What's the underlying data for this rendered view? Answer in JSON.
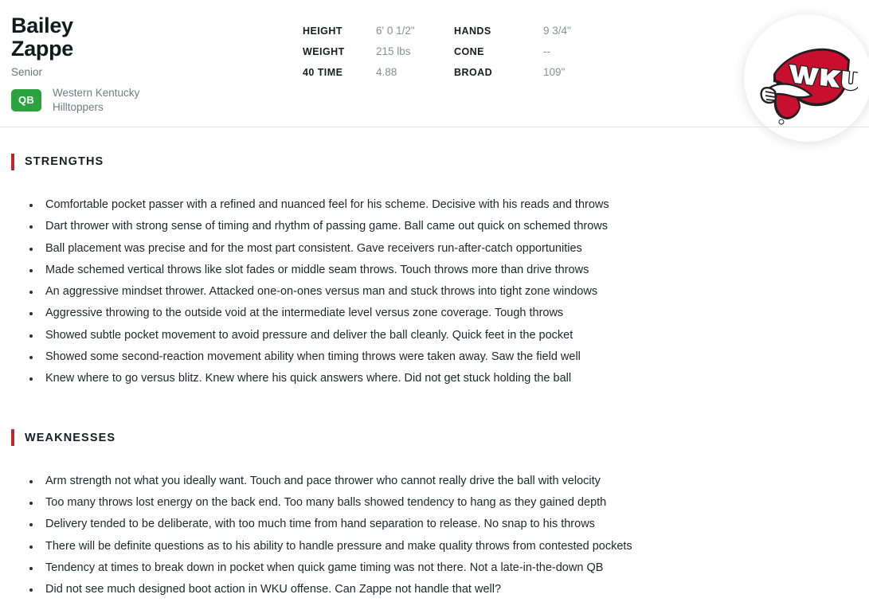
{
  "player": {
    "first_name": "Bailey",
    "last_name": "Zappe",
    "full_name": "Bailey\nZappe",
    "class_year": "Senior",
    "position": "QB",
    "team": "Western Kentucky\nHilltoppers",
    "team_abbr": "WKU"
  },
  "measurements": [
    {
      "label": "HEIGHT",
      "value": "6' 0 1/2\""
    },
    {
      "label": "HANDS",
      "value": "9 3/4\""
    },
    {
      "label": "WEIGHT",
      "value": "215 lbs"
    },
    {
      "label": "CONE",
      "value": "--"
    },
    {
      "label": "40 TIME",
      "value": "4.88"
    },
    {
      "label": "BROAD",
      "value": "109\""
    }
  ],
  "sections": {
    "strengths": {
      "title": "STRENGTHS",
      "items": [
        "Comfortable pocket passer with a refined and nuanced feel for his scheme. Decisive with his reads and throws",
        "Dart thrower with strong sense of timing and rhythm of passing game. Ball came out quick on schemed throws",
        "Ball placement was precise and for the most part consistent. Gave receivers run-after-catch opportunities",
        "Made schemed vertical throws like slot fades or middle seam throws. Touch throws more than drive throws",
        "An aggressive mindset thrower. Attacked one-on-ones versus man and stuck throws into tight zone windows",
        "Aggressive throwing to the outside void at the intermediate level versus zone coverage. Tough throws",
        "Showed subtle pocket movement to avoid pressure and deliver the ball cleanly. Quick feet in the pocket",
        "Showed some second-reaction movement ability when timing throws were taken away. Saw the field well",
        "Knew where to go versus blitz. Knew where his quick answers where. Did not get stuck holding the ball"
      ]
    },
    "weaknesses": {
      "title": "WEAKNESSES",
      "items": [
        "Arm strength not what you ideally want. Touch and pace thrower who cannot really drive the ball with velocity",
        "Too many throws lost energy on the back end. Too many balls showed tendency to hang as they gained depth",
        "Delivery tended to be deliberate, with too much time from hand separation to release. No snap to his throws",
        "There will be definite questions as to his ability to handle pressure and make quality throws from contested pockets",
        "Tendency at times to break down in pocket when quick game timing was not there. Not a late-in-the-down QB",
        "Did not see much designed boot action in WKU offense. Can Zappe not handle that well?"
      ]
    }
  },
  "colors": {
    "accent_red": "#b92a2a",
    "position_badge_green": "#2aa33f",
    "logo_red": "#c8102e",
    "text_primary": "#24262a",
    "text_muted": "#8b8e93",
    "divider": "#e3e3e5"
  }
}
